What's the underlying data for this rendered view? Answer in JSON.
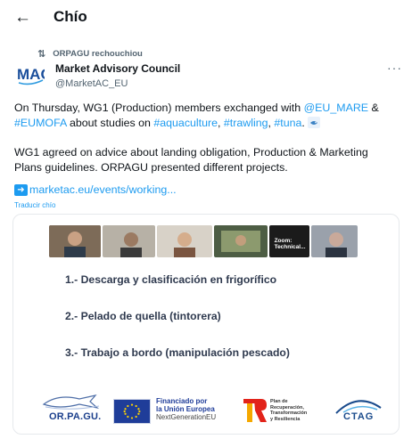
{
  "header": {
    "title": "Chío",
    "back_icon": "arrow-left-icon"
  },
  "retweet": {
    "text": "ORPAGU rechouchiou",
    "icon": "retweet-icon"
  },
  "author": {
    "name": "Market Advisory Council",
    "handle": "@MarketAC_EU",
    "avatar_text": "MAC"
  },
  "tweet": {
    "p1_a": "On Thursday, WG1 (Production) members exchanged with ",
    "p1_link1": "@EU_MARE",
    "p1_b": " & ",
    "p1_link2": "#EUMOFA",
    "p1_c": " about studies on ",
    "p1_link3": "#aquaculture",
    "p1_d": ", ",
    "p1_link4": "#trawling",
    "p1_e": ", ",
    "p1_link5": "#tuna",
    "p1_f": ". ",
    "p2": "WG1 agreed on advice about landing obligation, Production & Marketing Plans guidelines. ORPAGU presented different projects.",
    "url": "marketac.eu/events/working...",
    "translate": "Traducir chío"
  },
  "card": {
    "zoom_label": "Zoom: Technical...",
    "items": [
      "1.- Descarga y clasificación en frigorífico",
      "2.- Pelado de quella (tintorera)",
      "3.- Trabajo a bordo (manipulación pescado)"
    ],
    "logos": {
      "orpagu": "OR.PA.GU.",
      "eu_line1": "Financiado por",
      "eu_line2": "la Unión Europea",
      "eu_line3": "NextGenerationEU",
      "plan_line1": "Plan de",
      "plan_line2": "Recuperación,",
      "plan_line3": "Transformación",
      "plan_line4": "y Resiliencia",
      "ctag": "CTAG"
    }
  },
  "colors": {
    "link": "#1d9bf0",
    "text": "#0f1419",
    "muted": "#536471",
    "eu_blue": "#1f3d99"
  }
}
